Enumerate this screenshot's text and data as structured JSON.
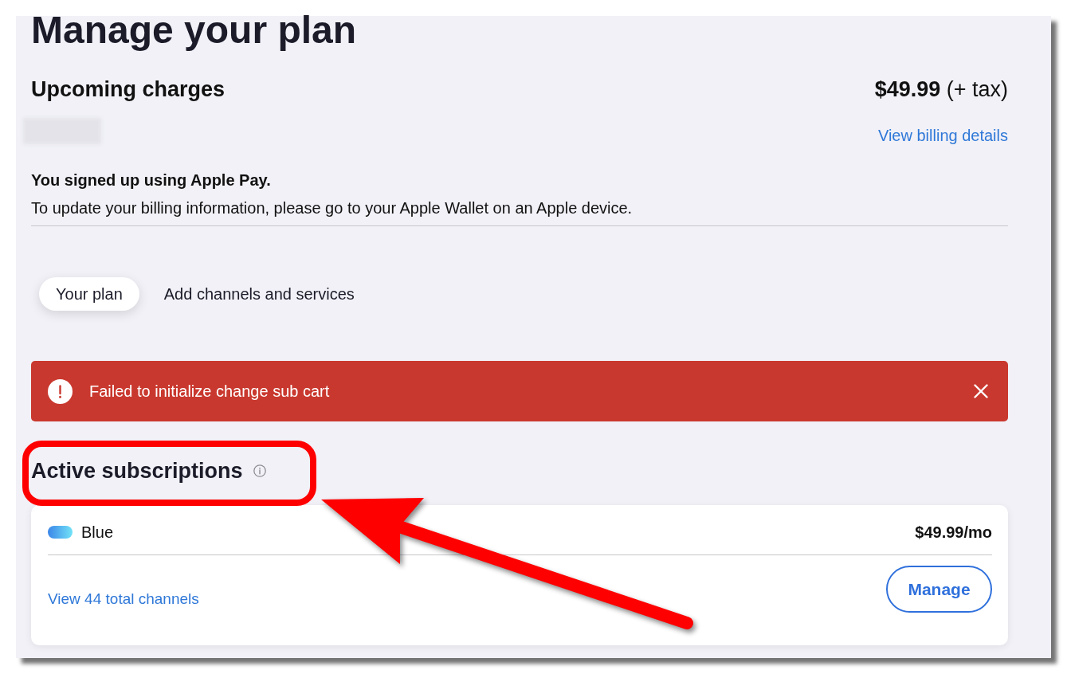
{
  "page_title": "Manage your plan",
  "upcoming_charges": {
    "heading": "Upcoming charges",
    "amount": "**$49.99** (+ tax)",
    "billing_link": "View billing details"
  },
  "payment_notice": {
    "title": "You signed up using Apple Pay.",
    "message": "To update your billing information, please go to your Apple Wallet on an Apple device."
  },
  "tabs": [
    {
      "label": "Your plan",
      "selected": true
    },
    {
      "label": "Add channels and services",
      "selected": false
    }
  ],
  "alert": {
    "message": "Failed to initialize change sub cart"
  },
  "active_subscriptions": {
    "heading": "Active subscriptions",
    "subscriptions": [
      {
        "name": "Blue",
        "price": "$49.99/mo",
        "channels_link": "View 44 total channels",
        "action": "Manage"
      }
    ]
  }
}
